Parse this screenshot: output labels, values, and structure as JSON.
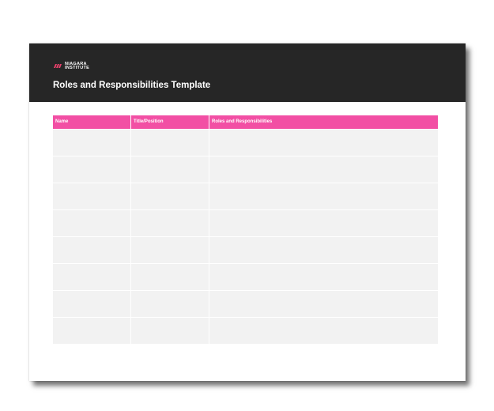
{
  "document": {
    "logo": {
      "line1": "NIAGARA",
      "line2": "INSTITUTE",
      "mark_color": "#e8416b"
    },
    "title": "Roles and Responsibilities Template",
    "table": {
      "columns": [
        "Name",
        "Title/Position",
        "Roles and Responsibilities"
      ],
      "rows": [
        [
          "",
          "",
          ""
        ],
        [
          "",
          "",
          ""
        ],
        [
          "",
          "",
          ""
        ],
        [
          "",
          "",
          ""
        ],
        [
          "",
          "",
          ""
        ],
        [
          "",
          "",
          ""
        ],
        [
          "",
          "",
          ""
        ],
        [
          "",
          "",
          ""
        ]
      ]
    },
    "colors": {
      "header_bg": "#262626",
      "table_header_bg": "#f24fa4",
      "cell_bg": "#f2f2f2"
    }
  }
}
